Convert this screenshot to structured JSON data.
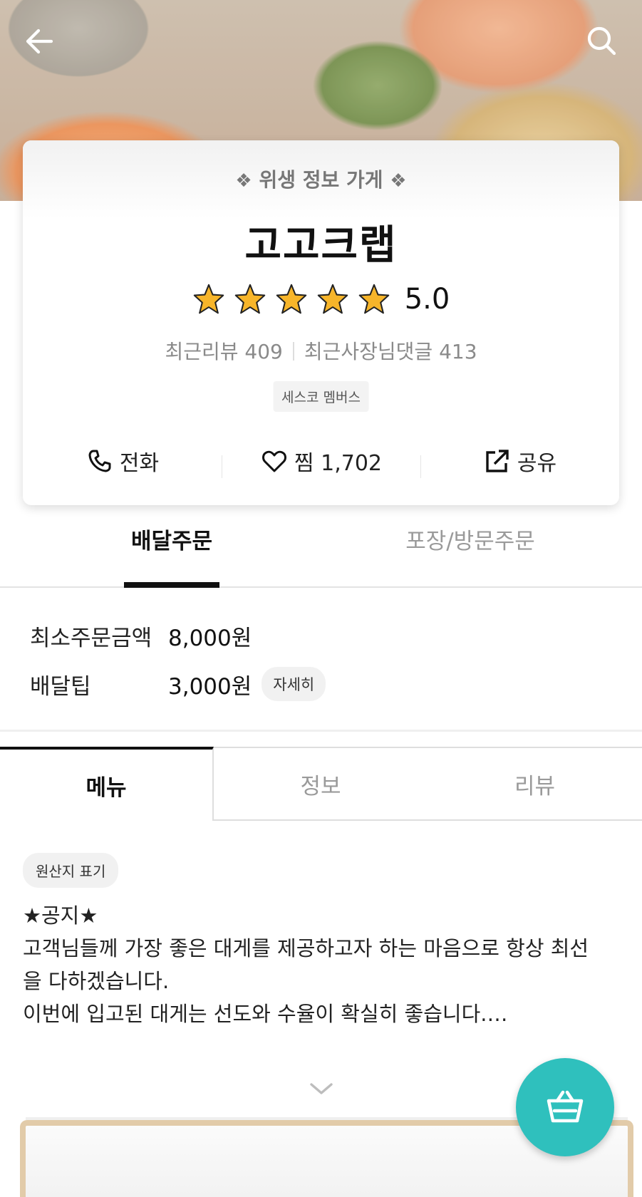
{
  "header": {
    "back_icon": "back-arrow-icon",
    "search_icon": "search-icon"
  },
  "store": {
    "hygiene_badge": "위생 정보 가게",
    "name": "고고크랩",
    "rating": "5.0",
    "stars": 5,
    "recent_reviews_label": "최근리뷰 409",
    "owner_replies_label": "최근사장님댓글 413",
    "cesco_badge": "세스코 멤버스"
  },
  "actions": {
    "call_label": "전화",
    "wish_label": "찜 1,702",
    "share_label": "공유"
  },
  "order_tabs": {
    "delivery": "배달주문",
    "pickup": "포장/방문주문"
  },
  "fees": {
    "min_order_label": "최소주문금액",
    "min_order_value": "8,000원",
    "delivery_tip_label": "배달팁",
    "delivery_tip_value": "3,000원",
    "detail_label": "자세히"
  },
  "info_tabs": {
    "menu": "메뉴",
    "info": "정보",
    "review": "리뷰"
  },
  "origin_label": "원산지 표기",
  "notice": {
    "line1": "★공지★",
    "line2": "고객님들께 가장 좋은 대게를 제공하고자 하는 마음으로 항상 최선",
    "line3": "을 다하겠습니다.",
    "line4": "이번에 입고된 대게는 선도와 수율이 확실히 좋습니다.…"
  },
  "colors": {
    "accent": "#2fc0bd",
    "star": "#f7b52a",
    "text": "#111111"
  }
}
